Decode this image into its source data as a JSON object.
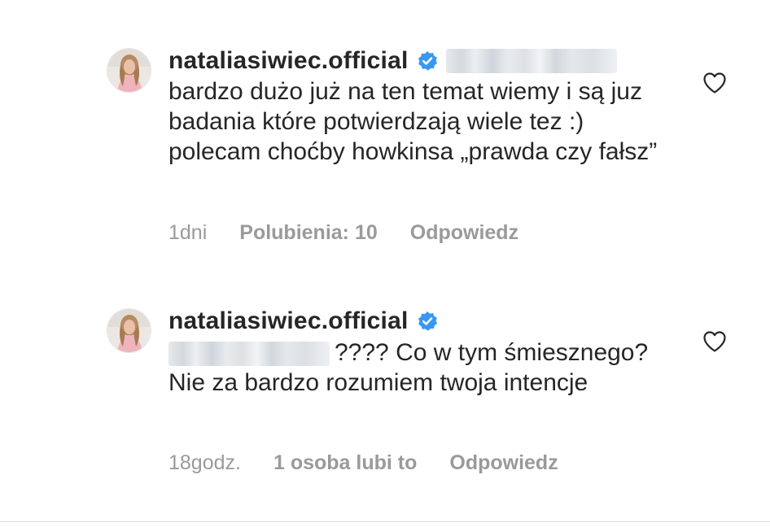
{
  "colors": {
    "text": "#262626",
    "meta": "#9a9a9a",
    "verified": "#3897f0",
    "divider": "#dbdbdb"
  },
  "comments": [
    {
      "username": "nataliasiwiec.official",
      "verified_icon": "verified-badge-icon",
      "text": "bardzo dużo już na ten temat wiemy i są juz badania które potwierdzają wiele tez :) polecam choćby howkinsa „prawda czy fałsz”",
      "time": "1dni",
      "likes": "Polubienia: 10",
      "reply": "Odpowiedz",
      "like_icon": "heart-icon"
    },
    {
      "username": "nataliasiwiec.official",
      "verified_icon": "verified-badge-icon",
      "text": "???? Co w tym śmiesznego?  Nie za bardzo rozumiem twoja intencje",
      "time": "18godz.",
      "likes": "1 osoba lubi to",
      "reply": "Odpowiedz",
      "like_icon": "heart-icon"
    }
  ]
}
